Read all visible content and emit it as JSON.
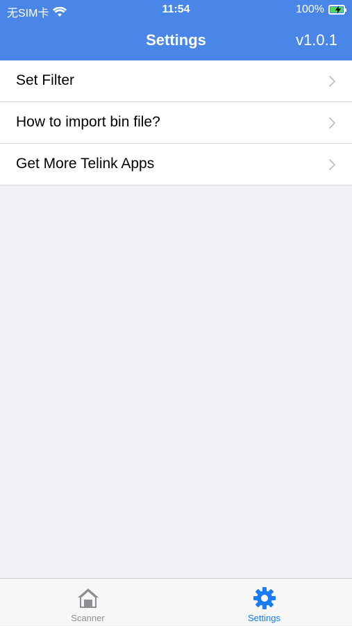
{
  "status_bar": {
    "carrier": "无SIM卡",
    "time": "11:54",
    "battery": "100%",
    "battery_level": 1.0,
    "icons": [
      "wifi-icon",
      "battery-icon",
      "charging-icon"
    ]
  },
  "nav": {
    "title": "Settings",
    "version": "v1.0.1"
  },
  "settings_list": {
    "items": [
      {
        "label": "Set Filter"
      },
      {
        "label": "How to import bin file?"
      },
      {
        "label": "Get More Telink Apps"
      }
    ]
  },
  "tabbar": {
    "tabs": [
      {
        "label": "Scanner",
        "icon": "home-icon",
        "active": false
      },
      {
        "label": "Settings",
        "icon": "gear-icon",
        "active": true
      }
    ]
  },
  "colors": {
    "header": "#4a86e8",
    "background": "#f0f0f5",
    "active_tab": "#1a7cf5",
    "inactive_tab": "#8e8e93"
  }
}
